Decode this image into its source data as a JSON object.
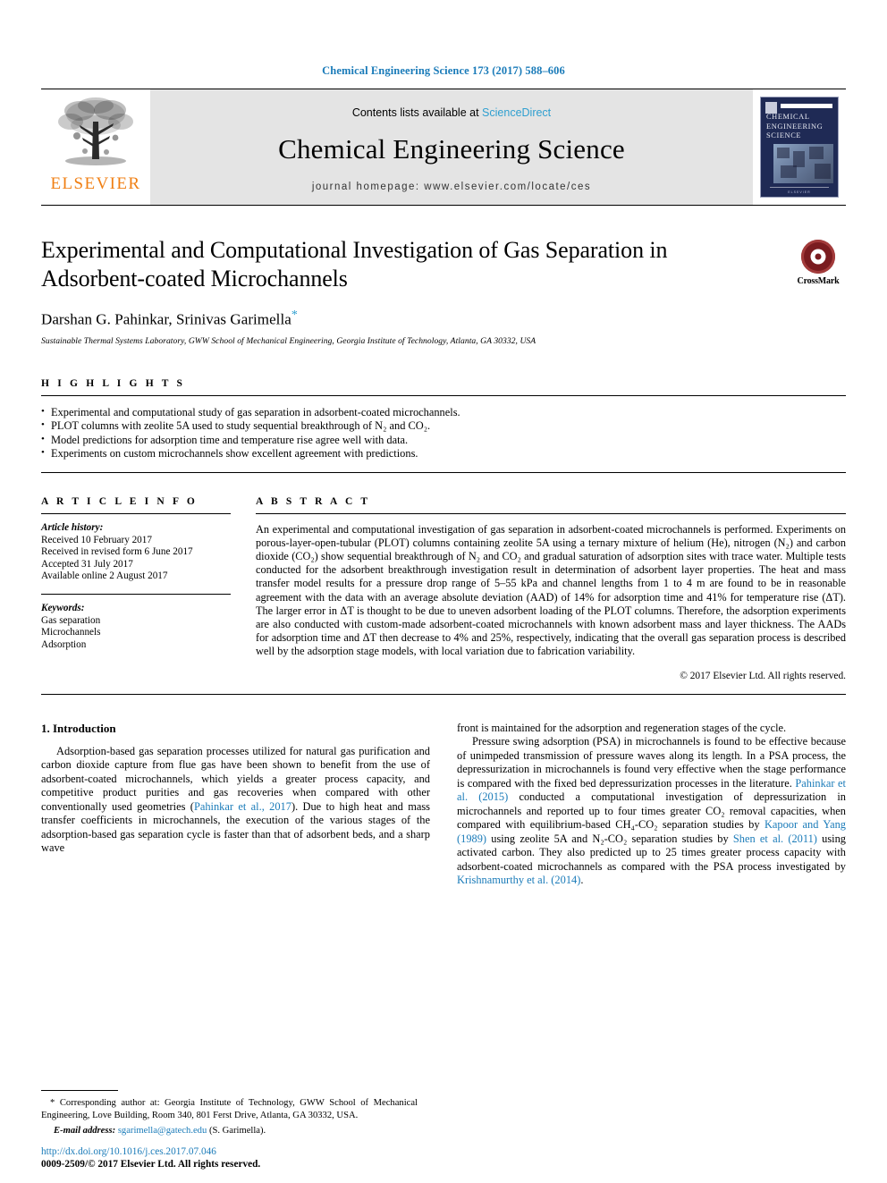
{
  "running_head": "Chemical Engineering Science 173 (2017) 588–606",
  "masthead": {
    "contents_prefix": "Contents lists available at",
    "sciencedirect": "ScienceDirect",
    "journal_title": "Chemical Engineering Science",
    "homepage": "journal homepage: www.elsevier.com/locate/ces",
    "publisher": "ELSEVIER",
    "logo_icon": "elsevier-tree-icon",
    "cover": {
      "line1": "CHEMICAL",
      "line2": "ENGINEERING",
      "line3": "SCIENCE",
      "footer": "ELSEVIER"
    },
    "link_color": "#2f9fd0"
  },
  "article": {
    "title": "Experimental and Computational Investigation of Gas Separation in Adsorbent-coated Microchannels",
    "authors": "Darshan G. Pahinkar, Srinivas Garimella",
    "corresponding_marker": "*",
    "affiliation": "Sustainable Thermal Systems Laboratory, GWW School of Mechanical Engineering, Georgia Institute of Technology, Atlanta, GA 30332, USA",
    "crossmark_label": "CrossMark",
    "crossmark_icon": "crossmark-logo-icon"
  },
  "highlights": {
    "heading": "H I G H L I G H T S",
    "items": [
      "Experimental and computational study of gas separation in adsorbent-coated microchannels.",
      "PLOT columns with zeolite 5A used to study sequential breakthrough of N₂ and CO₂.",
      "Model predictions for adsorption time and temperature rise agree well with data.",
      "Experiments on custom microchannels show excellent agreement with predictions."
    ]
  },
  "article_info": {
    "heading": "A R T I C L E   I N F O",
    "history_label": "Article history:",
    "history": [
      "Received 10 February 2017",
      "Received in revised form 6 June 2017",
      "Accepted 31 July 2017",
      "Available online 2 August 2017"
    ],
    "keywords_label": "Keywords:",
    "keywords": [
      "Gas separation",
      "Microchannels",
      "Adsorption"
    ]
  },
  "abstract": {
    "heading": "A B S T R A C T",
    "text": "An experimental and computational investigation of gas separation in adsorbent-coated microchannels is performed. Experiments on porous-layer-open-tubular (PLOT) columns containing zeolite 5A using a ternary mixture of helium (He), nitrogen (N₂) and carbon dioxide (CO₂) show sequential breakthrough of N₂ and CO₂ and gradual saturation of adsorption sites with trace water. Multiple tests conducted for the adsorbent breakthrough investigation result in determination of adsorbent layer properties. The heat and mass transfer model results for a pressure drop range of 5–55 kPa and channel lengths from 1 to 4 m are found to be in reasonable agreement with the data with an average absolute deviation (AAD) of 14% for adsorption time and 41% for temperature rise (ΔT). The larger error in ΔT is thought to be due to uneven adsorbent loading of the PLOT columns. Therefore, the adsorption experiments are also conducted with custom-made adsorbent-coated microchannels with known adsorbent mass and layer thickness. The AADs for adsorption time and ΔT then decrease to 4% and 25%, respectively, indicating that the overall gas separation process is described well by the adsorption stage models, with local variation due to fabrication variability.",
    "copyright": "© 2017 Elsevier Ltd. All rights reserved."
  },
  "body": {
    "section_heading": "1. Introduction",
    "left_paragraph_1a": "Adsorption-based gas separation processes utilized for natural gas purification and carbon dioxide capture from flue gas have been shown to benefit from the use of adsorbent-coated microchannels, which yields a greater process capacity, and competitive product purities and gas recoveries when compared with other conventionally used geometries (",
    "left_cite_1": "Pahinkar et al., 2017",
    "left_paragraph_1b": "). Due to high heat and mass transfer coefficients in microchannels, the execution of the various stages of the adsorption-based gas separation cycle is faster than that of adsorbent beds, and a sharp wave",
    "right_paragraph_1": "front is maintained for the adsorption and regeneration stages of the cycle.",
    "right_paragraph_2a": "Pressure swing adsorption (PSA) in microchannels is found to be effective because of unimpeded transmission of pressure waves along its length. In a PSA process, the depressurization in microchannels is found very effective when the stage performance is compared with the fixed bed depressurization processes in the literature. ",
    "right_cite_1": "Pahinkar et al. (2015)",
    "right_paragraph_2b": " conducted a computational investigation of depressurization in microchannels and reported up to four times greater CO₂ removal capacities, when compared with equilibrium-based CH₄-CO₂ separation studies by ",
    "right_cite_2": "Kapoor and Yang (1989)",
    "right_paragraph_2c": " using zeolite 5A and N₂-CO₂ separation studies by ",
    "right_cite_3": "Shen et al. (2011)",
    "right_paragraph_2d": " using activated carbon. They also predicted up to 25 times greater process capacity with adsorbent-coated microchannels as compared with the PSA process investigated by ",
    "right_cite_4": "Krishnamurthy et al. (2014)",
    "right_paragraph_2e": "."
  },
  "footnotes": {
    "corresponding": "* Corresponding author at: Georgia Institute of Technology, GWW School of Mechanical Engineering, Love Building, Room 340, 801 Ferst Drive, Atlanta, GA 30332, USA.",
    "email_label": "E-mail address:",
    "email": "sgarimella@gatech.edu",
    "email_suffix": "(S. Garimella).",
    "doi": "http://dx.doi.org/10.1016/j.ces.2017.07.046",
    "issn": "0009-2509/© 2017 Elsevier Ltd. All rights reserved."
  }
}
